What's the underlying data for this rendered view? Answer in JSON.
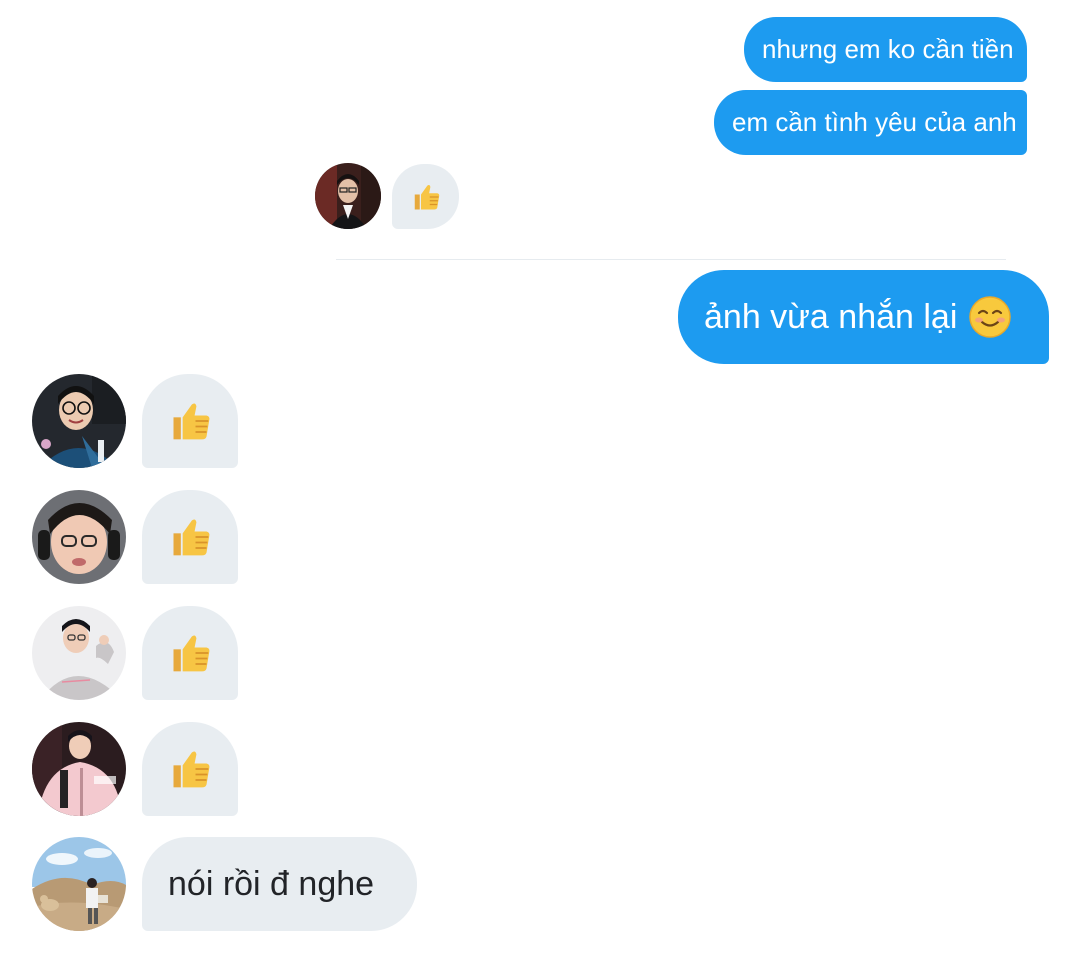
{
  "messages": {
    "sent_1": "nhưng em ko cần tiền",
    "sent_2": "em cần tình yêu của anh",
    "sent_3": "ảnh vừa nhắn lại",
    "received_last": "nói rồi đ nghe"
  },
  "icons": {
    "thumbs_up": "thumbs-up-emoji",
    "smiling_face": "smiling-face-emoji"
  },
  "colors": {
    "sent_bubble": "#1d9bf0",
    "received_bubble": "#e8edf1"
  }
}
